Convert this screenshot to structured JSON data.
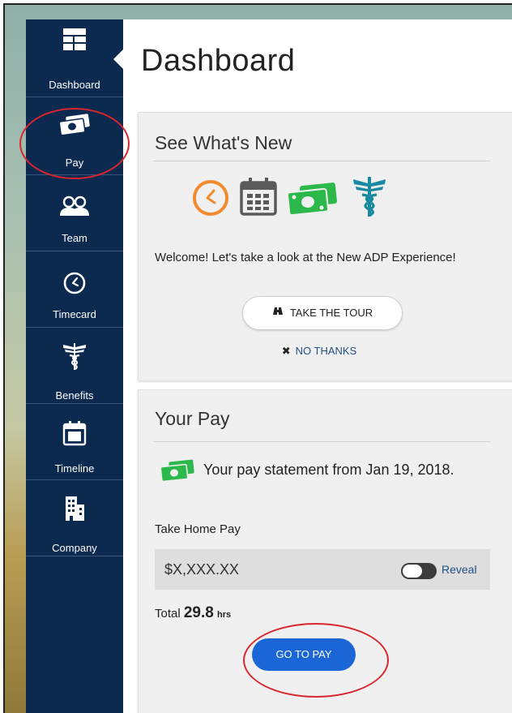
{
  "sidebar": {
    "items": [
      {
        "label": "Dashboard",
        "icon": "dashboard-icon"
      },
      {
        "label": "Pay",
        "icon": "money-icon"
      },
      {
        "label": "Team",
        "icon": "team-icon"
      },
      {
        "label": "Timecard",
        "icon": "clock-icon"
      },
      {
        "label": "Benefits",
        "icon": "caduceus-icon"
      },
      {
        "label": "Timeline",
        "icon": "calendar-icon"
      },
      {
        "label": "Company",
        "icon": "building-icon"
      }
    ],
    "active": "Dashboard"
  },
  "page": {
    "title": "Dashboard"
  },
  "whats_new": {
    "title": "See What's New",
    "icons": [
      "clock-icon",
      "calendar-icon",
      "money-icon",
      "caduceus-icon"
    ],
    "welcome": "Welcome! Let's take a look at the New ADP Experience!",
    "tour_button": "TAKE THE TOUR",
    "no_thanks": "NO THANKS"
  },
  "your_pay": {
    "title": "Your Pay",
    "statement": "Your pay statement from Jan 19, 2018.",
    "take_home_label": "Take Home Pay",
    "amount": "$X,XXX.XX",
    "reveal_label": "Reveal",
    "reveal_on": false,
    "total_prefix": "Total",
    "total_hours": "29.8",
    "total_unit": "hrs",
    "go_button": "GO TO PAY"
  },
  "colors": {
    "sidebar": "#0c2950",
    "accent_orange": "#f08a2c",
    "money_green": "#2db84b",
    "teal": "#1a8aa0",
    "button_blue": "#1a66d6",
    "link_blue": "#1f4f80",
    "annotation_red": "#d8262e"
  }
}
